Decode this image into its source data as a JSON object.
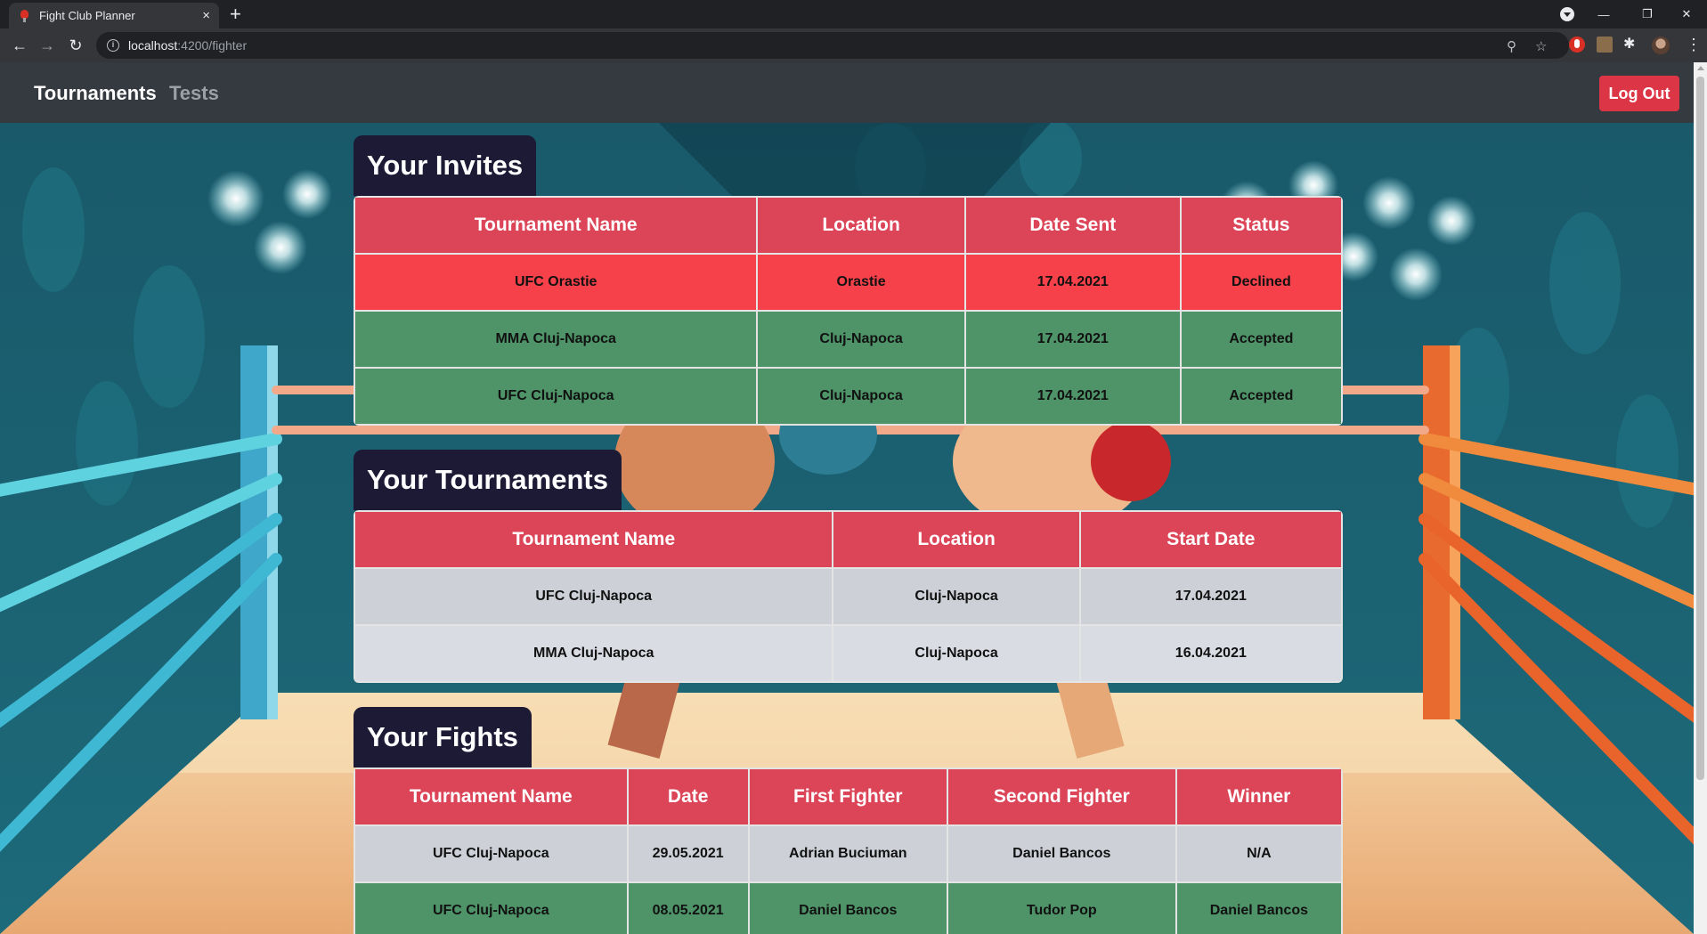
{
  "browser": {
    "tab_title": "Fight Club Planner",
    "tab_close": "×",
    "new_tab": "+",
    "url_host": "localhost",
    "url_rest": ":4200/fighter",
    "window_buttons": [
      "—",
      "❐",
      "✕"
    ]
  },
  "navbar": {
    "links": [
      "Tournaments",
      "Tests"
    ],
    "logout_label": "Log Out"
  },
  "colors": {
    "navbar": "#343a40",
    "header_red": "#dc4558",
    "declined": "#f7414a",
    "accepted": "#4e9468",
    "title_bg": "#1c1a35"
  },
  "invites": {
    "title": "Your Invites",
    "headers": [
      "Tournament Name",
      "Location",
      "Date Sent",
      "Status"
    ],
    "rows": [
      {
        "cells": [
          "UFC Orastie",
          "Orastie",
          "17.04.2021",
          "Declined"
        ]
      },
      {
        "cells": [
          "MMA Cluj-Napoca",
          "Cluj-Napoca",
          "17.04.2021",
          "Accepted"
        ]
      },
      {
        "cells": [
          "UFC Cluj-Napoca",
          "Cluj-Napoca",
          "17.04.2021",
          "Accepted"
        ]
      }
    ]
  },
  "tournaments": {
    "title": "Your Tournaments",
    "headers": [
      "Tournament Name",
      "Location",
      "Start Date"
    ],
    "rows": [
      {
        "cells": [
          "UFC Cluj-Napoca",
          "Cluj-Napoca",
          "17.04.2021"
        ]
      },
      {
        "cells": [
          "MMA Cluj-Napoca",
          "Cluj-Napoca",
          "16.04.2021"
        ]
      }
    ]
  },
  "fights": {
    "title": "Your Fights",
    "headers": [
      "Tournament Name",
      "Date",
      "First Fighter",
      "Second Fighter",
      "Winner"
    ],
    "rows": [
      {
        "cells": [
          "UFC Cluj-Napoca",
          "29.05.2021",
          "Adrian Buciuman",
          "Daniel Bancos",
          "N/A"
        ]
      },
      {
        "cells": [
          "UFC Cluj-Napoca",
          "08.05.2021",
          "Daniel Bancos",
          "Tudor Pop",
          "Daniel Bancos"
        ]
      }
    ]
  }
}
